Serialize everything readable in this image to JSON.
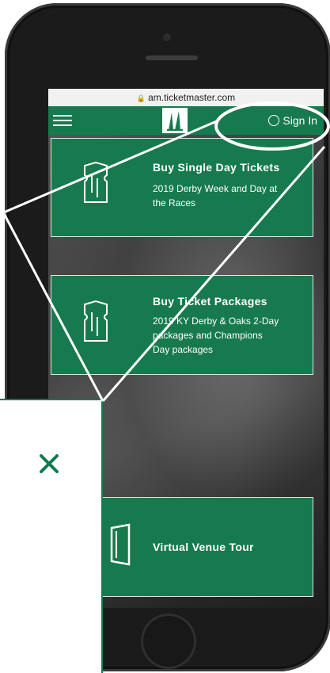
{
  "browser": {
    "url": "am.ticketmaster.com"
  },
  "header": {
    "menu_icon": "hamburger-menu-icon",
    "logo_icon": "twin-spires-logo",
    "signin_label": "Sign In"
  },
  "cards": [
    {
      "title": "Buy Single Day Tickets",
      "subtitle_lines": [
        "2019 Derby Week and Day at",
        "the Races"
      ],
      "icon": "ticket-icon"
    },
    {
      "title": "Buy Ticket Packages",
      "subtitle_lines": [
        "2019 KY Derby & Oaks 2-Day",
        "packages and Champions",
        "Day packages"
      ],
      "icon": "ticket-icon"
    },
    {
      "title": "Virtual Venue Tour",
      "subtitle_lines": [],
      "icon": "door-icon"
    }
  ],
  "callout": {
    "close_icon": "close-x-icon"
  },
  "colors": {
    "brand_green": "#177a4e",
    "close_x": "#0e7a4e"
  }
}
